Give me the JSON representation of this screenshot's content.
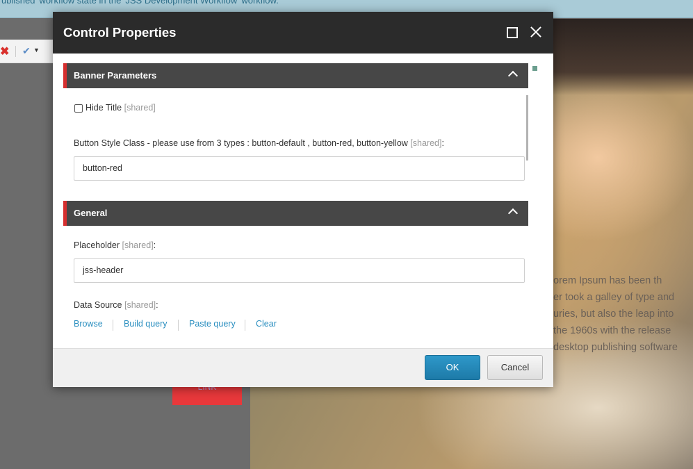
{
  "background": {
    "notice_text": "ublished' workflow state in the 'JSS Development Workflow' workflow.",
    "lorem_lines": [
      "orem Ipsum has been th",
      "er took a galley of type and",
      "uries, but also the leap into",
      " the 1960s with the release",
      "desktop publishing software"
    ],
    "link_label": "LINK"
  },
  "dialog": {
    "title": "Control Properties",
    "sections": {
      "banner": {
        "title": "Banner Parameters",
        "hide_title_label": "Hide Title",
        "hide_title_checked": false,
        "button_style_label": "Button Style Class - please use from 3 types : button-default , button-red, button-yellow",
        "button_style_value": "button-red"
      },
      "general": {
        "title": "General",
        "placeholder_label": "Placeholder",
        "placeholder_value": "jss-header",
        "datasource_label": "Data Source",
        "links": [
          "Browse",
          "Build query",
          "Paste query",
          "Clear"
        ]
      }
    },
    "shared_tag": "[shared]",
    "colon": ":",
    "ok_label": "OK",
    "cancel_label": "Cancel"
  },
  "colors": {
    "header_bg": "#2b2b2b",
    "section_bg": "#474747",
    "section_accent": "#d62f2f",
    "link": "#2b8fc0",
    "ok_button": "#1d7aa8"
  },
  "icons": [
    "maximize-icon",
    "close-icon",
    "chevron-up-icon",
    "delete-icon",
    "checklist-icon"
  ]
}
